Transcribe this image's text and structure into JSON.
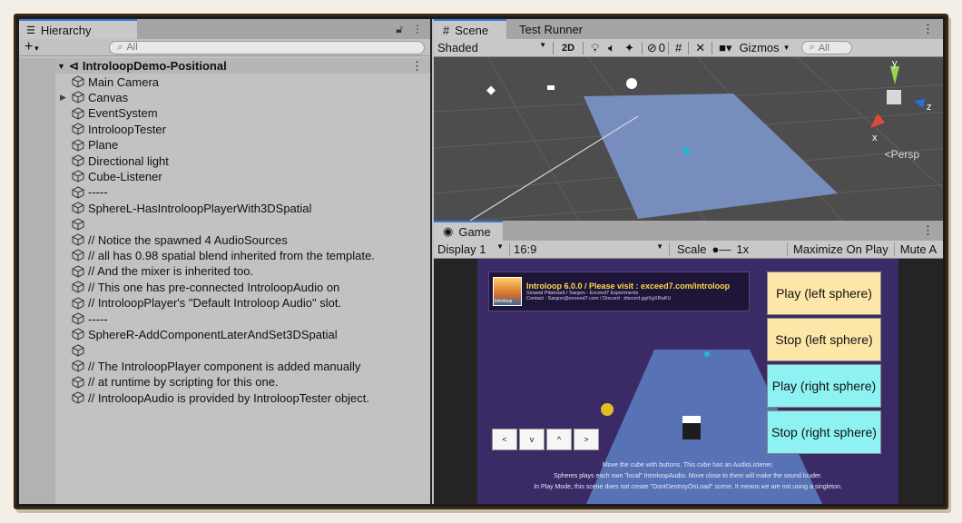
{
  "hierarchy": {
    "tab_label": "Hierarchy",
    "add_label": "+",
    "search_placeholder": "All",
    "root": "IntroloopDemo-Positional",
    "items": [
      {
        "label": "Main Camera",
        "expandable": false
      },
      {
        "label": "Canvas",
        "expandable": true
      },
      {
        "label": "EventSystem",
        "expandable": false
      },
      {
        "label": "IntroloopTester",
        "expandable": false
      },
      {
        "label": "Plane",
        "expandable": false
      },
      {
        "label": "Directional light",
        "expandable": false
      },
      {
        "label": "Cube-Listener",
        "expandable": false
      },
      {
        "label": "-----",
        "expandable": false
      },
      {
        "label": "SphereL-HasIntroloopPlayerWith3DSpatial",
        "expandable": false
      },
      {
        "label": "",
        "expandable": false
      },
      {
        "label": "// Notice the spawned 4 AudioSources",
        "expandable": false
      },
      {
        "label": "// all has 0.98 spatial blend inherited from the template.",
        "expandable": false
      },
      {
        "label": "// And the mixer is inherited too.",
        "expandable": false
      },
      {
        "label": "// This one has pre-connected IntroloopAudio on",
        "expandable": false
      },
      {
        "label": "// IntroloopPlayer's \"Default Introloop Audio\" slot.",
        "expandable": false
      },
      {
        "label": "-----",
        "expandable": false
      },
      {
        "label": "SphereR-AddComponentLaterAndSet3DSpatial",
        "expandable": false
      },
      {
        "label": "",
        "expandable": false
      },
      {
        "label": "// The IntroloopPlayer component is added manually",
        "expandable": false
      },
      {
        "label": "// at runtime by scripting for this one.",
        "expandable": false
      },
      {
        "label": "// IntroloopAudio is provided by IntroloopTester object.",
        "expandable": false
      }
    ]
  },
  "scene": {
    "tabs": [
      "Scene",
      "Test Runner"
    ],
    "shading": "Shaded",
    "mode_2d": "2D",
    "hidden_count": "0",
    "gizmos": "Gizmos",
    "search_placeholder": "All",
    "persp": "Persp",
    "axis_y": "y",
    "axis_x": "x",
    "axis_z": "z"
  },
  "game": {
    "tab": "Game",
    "display": "Display 1",
    "aspect": "16:9",
    "scale_label": "Scale",
    "scale_value": "1x",
    "maximize": "Maximize On Play",
    "mute": "Mute A",
    "banner_title": "Introloop 6.0.0 / Please visit : exceed7.com/introloop",
    "banner_line2": "Sirawat Pitaksarit / Sargon - Exceed7 Experiments",
    "banner_line3": "Contact : Sargon@exceed7.com / Discord : discord.gg/XgXRaKU",
    "logo_text": "Introloop",
    "buttons": [
      "Play (left sphere)",
      "Stop (left sphere)",
      "Play (right sphere)",
      "Stop (right sphere)"
    ],
    "arrows": [
      "<",
      "v",
      "^",
      ">"
    ],
    "notes": [
      "Move the cube with buttons. This cube has an AudioListener.",
      "Spheres plays each own \"local\" IntroloopAudio. Move close to them will make the sound louder.",
      "In Play Mode, this scene does not create \"DontDestroyOnLoad\" scene. It means we are not using a singleton."
    ]
  },
  "colors": {
    "accent": "#3a79d6",
    "plane": "#7b93c7",
    "btn_yellow": "#fde7a8",
    "btn_cyan": "#8ef2f2"
  }
}
